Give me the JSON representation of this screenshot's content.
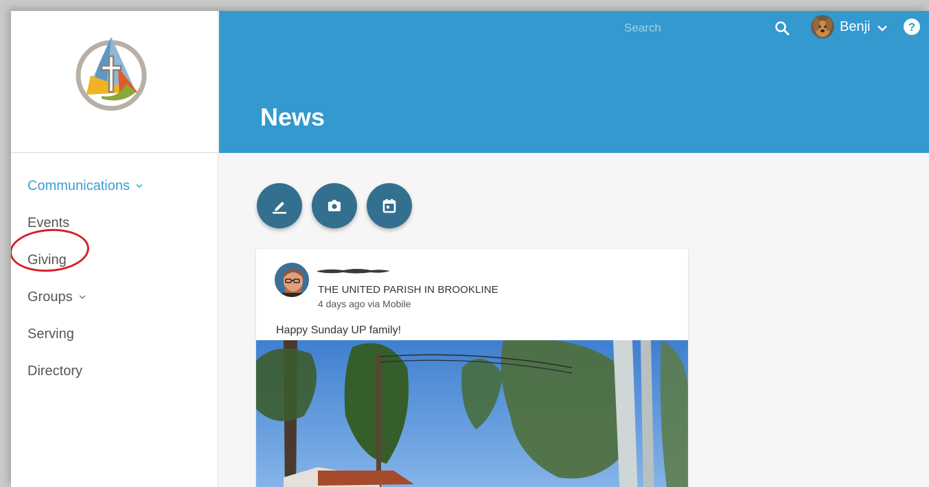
{
  "sidebar": {
    "items": [
      {
        "label": "Communications",
        "active": true,
        "has_dropdown": true
      },
      {
        "label": "Events",
        "active": false,
        "has_dropdown": false
      },
      {
        "label": "Giving",
        "active": false,
        "has_dropdown": false,
        "highlighted": true
      },
      {
        "label": "Groups",
        "active": false,
        "has_dropdown": true
      },
      {
        "label": "Serving",
        "active": false,
        "has_dropdown": false
      },
      {
        "label": "Directory",
        "active": false,
        "has_dropdown": false
      }
    ]
  },
  "header": {
    "search_placeholder": "Search",
    "user_name": "Benji",
    "page_title": "News"
  },
  "actions": [
    {
      "icon": "pencil-icon"
    },
    {
      "icon": "camera-icon"
    },
    {
      "icon": "calendar-icon"
    }
  ],
  "post": {
    "author_redacted": true,
    "organization": "THE UNITED PARISH IN BROOKLINE",
    "meta": "4 days ago via Mobile",
    "text": "Happy Sunday UP family!"
  },
  "colors": {
    "accent": "#3399cf",
    "active_nav": "#3a9fd0",
    "action_button": "#33708f",
    "highlight_ring": "#d4202a"
  }
}
